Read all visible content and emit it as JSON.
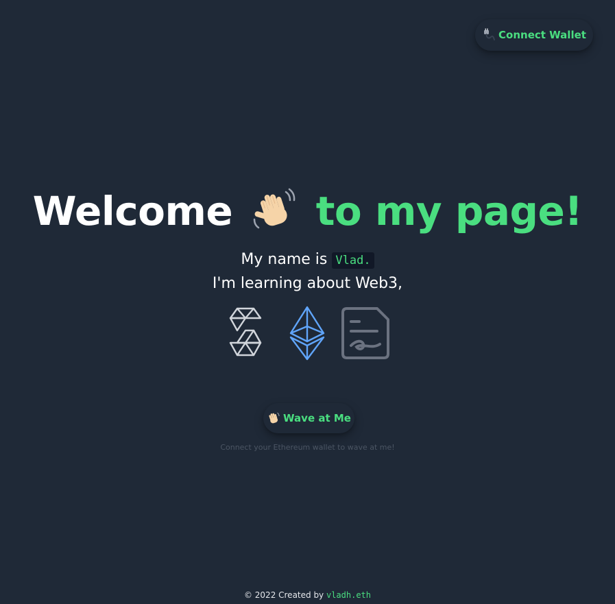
{
  "header": {
    "connect_wallet_label": "Connect Wallet",
    "connect_icon": "plug-icon"
  },
  "hero": {
    "title_part1": "Welcome",
    "title_emoji": "waving-hand-icon",
    "title_part2": "to my page!",
    "intro_prefix": "My name is ",
    "name": "Vlad.",
    "learning_line": "I'm learning about Web3,"
  },
  "logos": [
    {
      "name": "solana-logo-icon"
    },
    {
      "name": "ethereum-logo-icon"
    },
    {
      "name": "contract-document-icon"
    }
  ],
  "wave": {
    "button_label": "Wave at Me",
    "button_icon": "waving-hand-icon",
    "hint": "Connect your Ethereum wallet to wave at me!"
  },
  "footer": {
    "prefix": "© 2022 Created by ",
    "author": "vladh.eth"
  },
  "colors": {
    "background": "#1f2937",
    "accent": "#4ade80",
    "ethereum": "#60a5fa",
    "muted": "#4b5563"
  }
}
